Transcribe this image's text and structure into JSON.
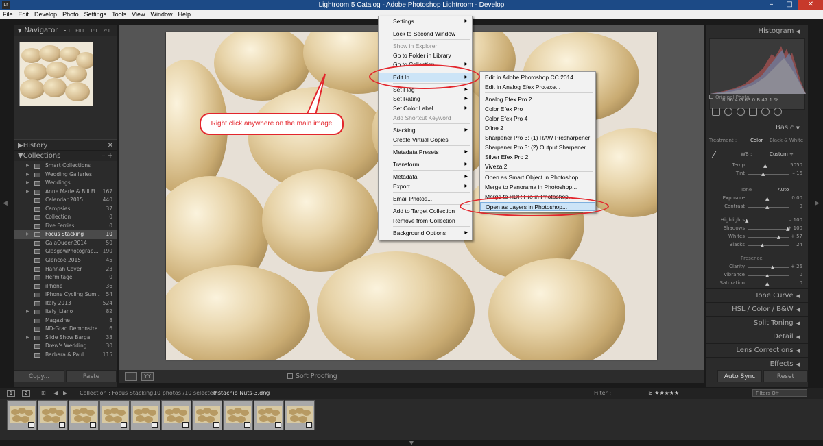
{
  "window": {
    "title": "Lightroom 5 Catalog - Adobe Photoshop Lightroom - Develop",
    "app_icon": "Lr",
    "minimize": "–",
    "maximize": "□",
    "close": "✕"
  },
  "menubar": [
    "File",
    "Edit",
    "Develop",
    "Photo",
    "Settings",
    "Tools",
    "View",
    "Window",
    "Help"
  ],
  "left": {
    "navigator_title": "Navigator",
    "navigator_options": [
      "FIT",
      "FILL",
      "1:1",
      "2:1"
    ],
    "history_title": "History",
    "collections_title": "Collections",
    "collections": [
      {
        "name": "Smart Collections",
        "count": ""
      },
      {
        "name": "Wedding Galleries",
        "count": ""
      },
      {
        "name": "Weddings",
        "count": ""
      },
      {
        "name": "Anne Marie & Bill Fi...",
        "count": "167"
      },
      {
        "name": "Calendar 2015",
        "count": "440"
      },
      {
        "name": "Campsies",
        "count": "37"
      },
      {
        "name": "Collection",
        "count": "0"
      },
      {
        "name": "Five Ferries",
        "count": "0"
      },
      {
        "name": "Focus Stacking",
        "count": "10"
      },
      {
        "name": "GalaQueen2014",
        "count": "50"
      },
      {
        "name": "GlasgowPhotograp...",
        "count": "190"
      },
      {
        "name": "Glencoe 2015",
        "count": "45"
      },
      {
        "name": "Hannah Cover",
        "count": "23"
      },
      {
        "name": "Hermitage",
        "count": "0"
      },
      {
        "name": "iPhone",
        "count": "36"
      },
      {
        "name": "iPhone Cycling Sum...",
        "count": "54"
      },
      {
        "name": "Italy 2013",
        "count": "524"
      },
      {
        "name": "Italy_Liano",
        "count": "82"
      },
      {
        "name": "Magazine",
        "count": "8"
      },
      {
        "name": "ND-Grad Demonstra...",
        "count": "6"
      },
      {
        "name": "Slide Show Barga",
        "count": "33"
      },
      {
        "name": "Drew's Wedding",
        "count": "30"
      },
      {
        "name": "Barbara & Paul",
        "count": "115"
      }
    ],
    "copy_label": "Copy...",
    "paste_label": "Paste"
  },
  "toolbar": {
    "soft_proofing": "Soft Proofing",
    "yy_label": "YY"
  },
  "callout_text": "Right click anywhere on the main image",
  "context_menu": [
    {
      "label": "Settings",
      "submenu": true
    },
    {
      "label": "Lock to Second Window"
    },
    {
      "label": "Show in Explorer",
      "disabled": true
    },
    {
      "label": "Go to Folder in Library"
    },
    {
      "label": "Go to Collection",
      "submenu": true
    },
    {
      "label": "Edit In",
      "submenu": true,
      "highlight": true
    },
    {
      "label": "Set Flag",
      "submenu": true
    },
    {
      "label": "Set Rating",
      "submenu": true
    },
    {
      "label": "Set Color Label",
      "submenu": true
    },
    {
      "label": "Add Shortcut Keyword",
      "disabled": true
    },
    {
      "label": "Stacking",
      "submenu": true
    },
    {
      "label": "Create Virtual Copies"
    },
    {
      "label": "Metadata Presets",
      "submenu": true
    },
    {
      "label": "Transform",
      "submenu": true
    },
    {
      "label": "Metadata",
      "submenu": true
    },
    {
      "label": "Export",
      "submenu": true
    },
    {
      "label": "Email Photos..."
    },
    {
      "label": "Add to Target Collection"
    },
    {
      "label": "Remove from Collection"
    },
    {
      "label": "Background Options",
      "submenu": true
    }
  ],
  "edit_in_submenu": [
    "Edit in Adobe Photoshop CC 2014...",
    "Edit in Analog Efex Pro.exe...",
    "Analog Efex Pro 2",
    "Color Efex Pro",
    "Color Efex Pro 4",
    "Dfine 2",
    "Sharpener Pro 3: (1) RAW Presharpener",
    "Sharpener Pro 3: (2) Output Sharpener",
    "Silver Efex Pro 2",
    "Viveza 2",
    "Open as Smart Object in Photoshop...",
    "Merge to Panorama in Photoshop...",
    "Merge to HDR Pro in Photoshop...",
    "Open as Layers in Photoshop..."
  ],
  "right": {
    "histogram_title": "Histogram",
    "readout": "R 66.4  G 63.0  B 47.1 %",
    "original_photo": "Original Photo",
    "basic_title": "Basic",
    "treatment_label": "Treatment :",
    "treatment_color": "Color",
    "treatment_bw": "Black & White",
    "wb_label": "WB :",
    "wb_value": "Custom ÷",
    "tone_label": "Tone",
    "tone_auto": "Auto",
    "presence_label": "Presence",
    "sliders": [
      {
        "label": "Temp",
        "value": "5050",
        "pos": 0.45
      },
      {
        "label": "Tint",
        "value": "– 16",
        "pos": 0.4
      },
      {
        "label": "Exposure",
        "value": "0.00",
        "pos": 0.5
      },
      {
        "label": "Contrast",
        "value": "0",
        "pos": 0.5
      },
      {
        "label": "Highlights",
        "value": "– 100",
        "pos": 0.0
      },
      {
        "label": "Shadows",
        "value": "+ 100",
        "pos": 1.0
      },
      {
        "label": "Whites",
        "value": "+ 57",
        "pos": 0.78
      },
      {
        "label": "Blacks",
        "value": "– 24",
        "pos": 0.38
      },
      {
        "label": "Clarity",
        "value": "+ 26",
        "pos": 0.63
      },
      {
        "label": "Vibrance",
        "value": "0",
        "pos": 0.5
      },
      {
        "label": "Saturation",
        "value": "0",
        "pos": 0.5
      }
    ],
    "sections": [
      "Tone Curve",
      "HSL / Color / B&W",
      "Split Toning",
      "Detail",
      "Lens Corrections",
      "Effects"
    ],
    "auto_sync": "Auto Sync",
    "reset": "Reset"
  },
  "filmstrip": {
    "page1": "1",
    "page2": "2",
    "source": "Collection : Focus Stacking",
    "count": "10 photos /10 selected /",
    "filename": "Pistachio Nuts-3.dng",
    "filter_label": "Filter :",
    "filters_off": "Filters Off",
    "thumb_count": 10
  }
}
